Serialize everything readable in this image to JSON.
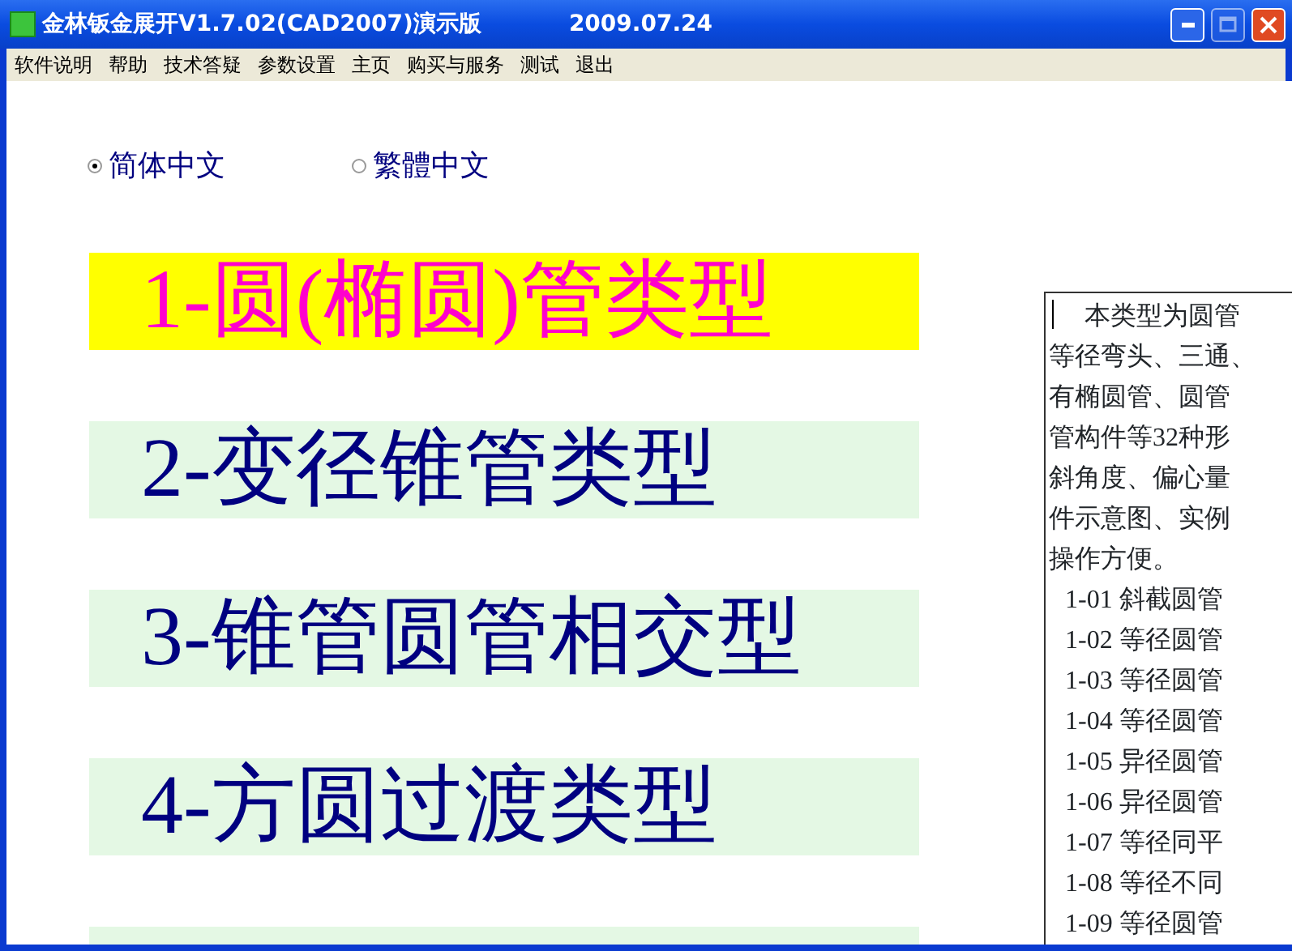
{
  "window": {
    "title": "金林钣金展开V1.7.02(CAD2007)演示版",
    "date": "2009.07.24",
    "maximize_disabled": true
  },
  "menu": [
    "软件说明",
    "帮助",
    "技术答疑",
    "参数设置",
    "主页",
    "购买与服务",
    "测试",
    "退出"
  ],
  "languages": [
    {
      "label": "简体中文",
      "selected": true
    },
    {
      "label": "繁體中文",
      "selected": false
    }
  ],
  "categories": [
    {
      "label": "1-圆(椭圆)管类型",
      "selected": true
    },
    {
      "label": "2-变径锥管类型",
      "selected": false
    },
    {
      "label": "3-锥管圆管相交型",
      "selected": false
    },
    {
      "label": "4-方圆过渡类型",
      "selected": false
    },
    {
      "selected": false
    }
  ],
  "description": {
    "lines": [
      "本类型为圆管",
      "等径弯头、三通、",
      "有椭圆管、圆管",
      "管构件等32种形",
      "斜角度、偏心量",
      "件示意图、实例",
      "操作方便。"
    ],
    "items": [
      "1-01 斜截圆管",
      "1-02 等径圆管",
      "1-03 等径圆管",
      "1-04 等径圆管",
      "1-05 异径圆管",
      "1-06 异径圆管",
      "1-07 等径同平",
      "1-08 等径不同",
      "1-09 等径圆管"
    ]
  }
}
